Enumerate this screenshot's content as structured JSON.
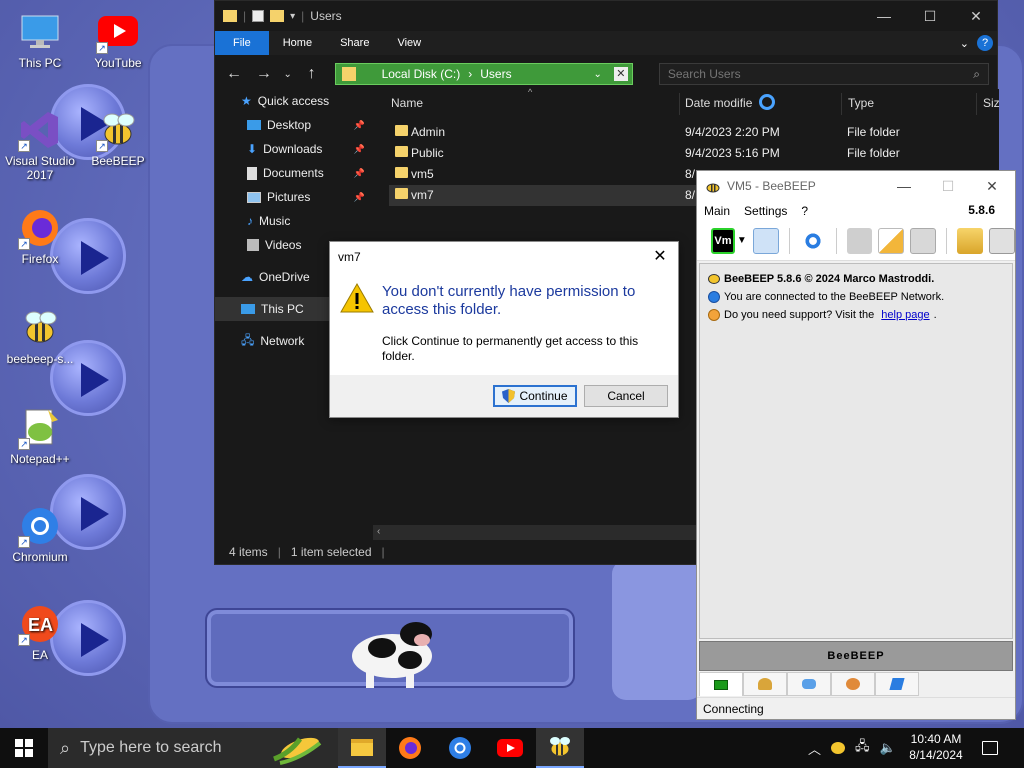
{
  "desktop": {
    "icons": [
      {
        "label": "This PC"
      },
      {
        "label": "YouTube"
      },
      {
        "label": "Visual Studio 2017"
      },
      {
        "label": "BeeBEEP"
      },
      {
        "label": "Firefox"
      },
      {
        "label": "beebeep-s..."
      },
      {
        "label": "Notepad++"
      },
      {
        "label": "Chromium"
      },
      {
        "label": "EA"
      }
    ]
  },
  "explorer": {
    "title": "Users",
    "ribbon_tabs": [
      "File",
      "Home",
      "Share",
      "View"
    ],
    "address": {
      "segment1": "Local Disk (C:)",
      "separator": "›",
      "segment2": "Users"
    },
    "search_placeholder": "Search Users",
    "sidebar": {
      "quick_access": "Quick access",
      "pinned": [
        "Desktop",
        "Downloads",
        "Documents",
        "Pictures"
      ],
      "other": [
        "Music",
        "Videos"
      ],
      "onedrive": "OneDrive",
      "this_pc": "This PC",
      "network": "Network"
    },
    "columns": {
      "name": "Name",
      "date": "Date modifie",
      "type": "Type",
      "size": "Siz"
    },
    "rows": [
      {
        "name": "Admin",
        "date": "9/4/2023 2:20 PM",
        "type": "File folder"
      },
      {
        "name": "Public",
        "date": "9/4/2023 5:16 PM",
        "type": "File folder"
      },
      {
        "name": "vm5",
        "date": "8/",
        "type": ""
      },
      {
        "name": "vm7",
        "date": "8/",
        "type": ""
      }
    ],
    "status": {
      "items": "4 items",
      "selected": "1 item selected"
    }
  },
  "dialog": {
    "title": "vm7",
    "main_message": "You don't currently have permission to access this folder.",
    "sub_message": "Click Continue to permanently get access to this folder.",
    "continue_label": "Continue",
    "cancel_label": "Cancel"
  },
  "beebeep": {
    "title": "VM5 - BeeBEEP",
    "menu": [
      "Main",
      "Settings",
      "?"
    ],
    "version": "5.8.6",
    "account_badge": "Vm",
    "chat_lines": {
      "copyright": "BeeBEEP 5.8.6 © 2024 Marco Mastroddi.",
      "connected": "You are connected to the BeeBEEP Network.",
      "support_prefix": "Do you need support? Visit the ",
      "support_link": "help page",
      "support_suffix": "."
    },
    "banner": "BeeBEEP",
    "status": "Connecting"
  },
  "taskbar": {
    "search_placeholder": "Type here to search",
    "time": "10:40 AM",
    "date": "8/14/2024"
  },
  "colors": {
    "explorer_bg": "#191919",
    "file_tab": "#1a72d6",
    "address_bar": "#3f9a3a",
    "dialog_heading": "#1c3a9e",
    "link": "#0000cc"
  }
}
